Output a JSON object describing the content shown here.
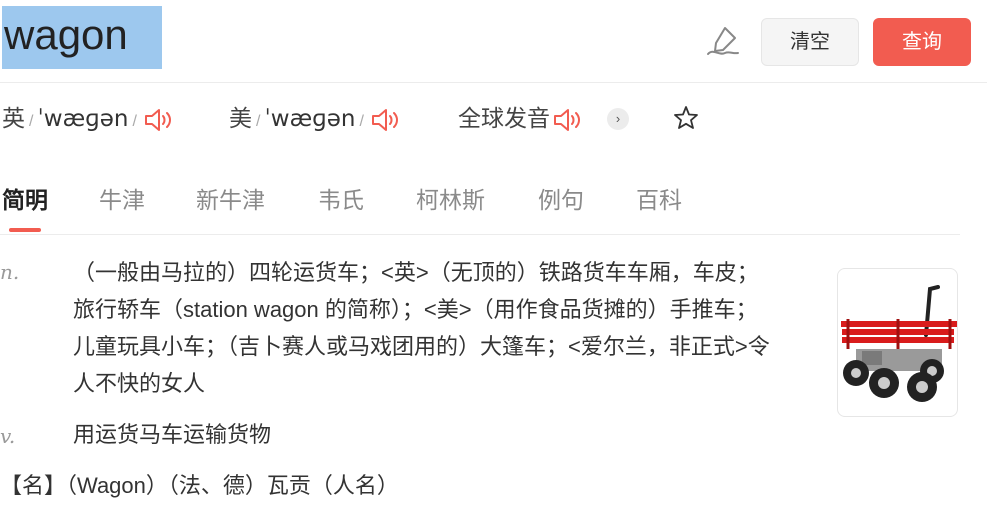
{
  "search": {
    "word": "wagon"
  },
  "buttons": {
    "clear": "清空",
    "query": "查询"
  },
  "pronunciation": {
    "uk_label": "英",
    "uk_ipa": "ˈwæɡən",
    "us_label": "美",
    "us_ipa": "ˈwæɡən",
    "global_label": "全球发音"
  },
  "tabs": [
    "简明",
    "牛津",
    "新牛津",
    "韦氏",
    "柯林斯",
    "例句",
    "百科"
  ],
  "definitions": [
    {
      "pos": "n.",
      "text": "（一般由马拉的）四轮运货车；<英>（无顶的）铁路货车车厢，车皮；旅行轿车（station wagon 的简称）；<美>（用作食品货摊的）手推车；儿童玩具小车；（吉卜赛人或马戏团用的）大篷车；<爱尔兰，非正式>令人不快的女人"
    },
    {
      "pos": "v.",
      "text": "用运货马车运输货物"
    }
  ],
  "name_entry": "【名】（Wagon）（法、德）瓦贡（人名）",
  "colors": {
    "accent": "#f25c50",
    "highlight": "#9dc8ee"
  },
  "icons": {
    "pen": "pen-icon",
    "speaker": "speaker-icon",
    "arrow": "chevron-right-icon",
    "star": "star-icon"
  }
}
